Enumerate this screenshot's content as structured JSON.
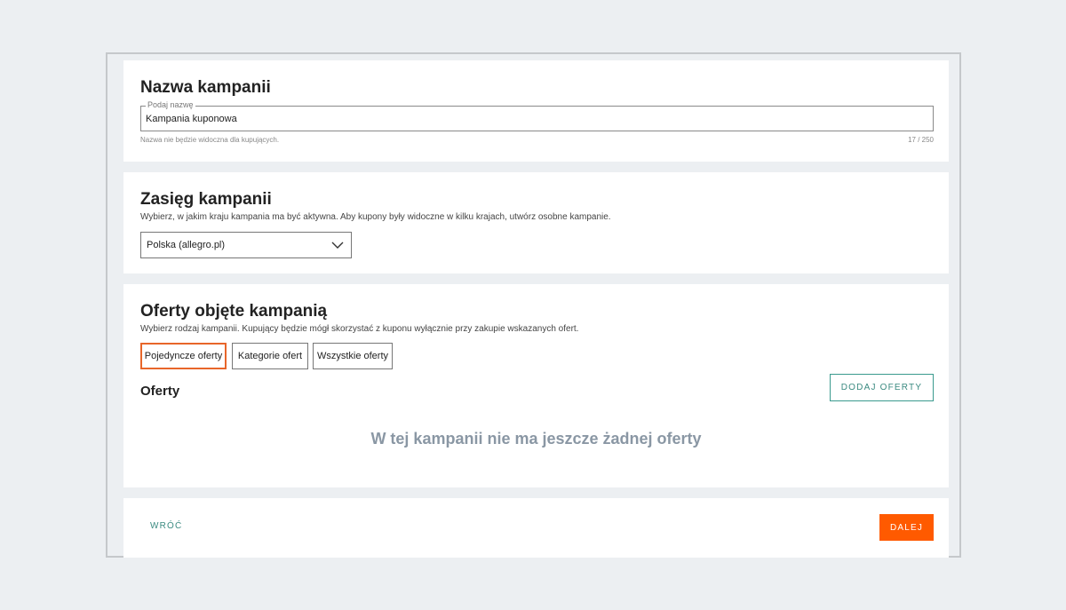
{
  "name_section": {
    "title": "Nazwa kampanii",
    "field_label": "Podaj nazwę",
    "field_value": "Kampania kuponowa",
    "hint": "Nazwa nie będzie widoczna dla kupujących.",
    "counter": "17 / 250"
  },
  "scope_section": {
    "title": "Zasięg kampanii",
    "description": "Wybierz, w jakim kraju kampania ma być aktywna. Aby kupony były widoczne w kilku krajach, utwórz osobne kampanie.",
    "selected_country": "Polska (allegro.pl)"
  },
  "offers_section": {
    "title": "Oferty objęte kampanią",
    "description": "Wybierz rodzaj kampanii. Kupujący będzie mógł skorzystać z kuponu wyłącznie przy zakupie wskazanych ofert.",
    "types": [
      "Pojedyncze oferty",
      "Kategorie ofert",
      "Wszystkie oferty"
    ],
    "active_type": "Pojedyncze oferty",
    "offers_heading": "Oferty",
    "add_button": "DODAJ OFERTY",
    "empty_message": "W tej kampanii nie ma jeszcze żadnej oferty"
  },
  "footer": {
    "back_label": "WRÓĆ",
    "next_label": "DALEJ"
  },
  "colors": {
    "accent": "#ff5a00",
    "teal": "#3a8a80",
    "active_border": "#e8662a"
  }
}
